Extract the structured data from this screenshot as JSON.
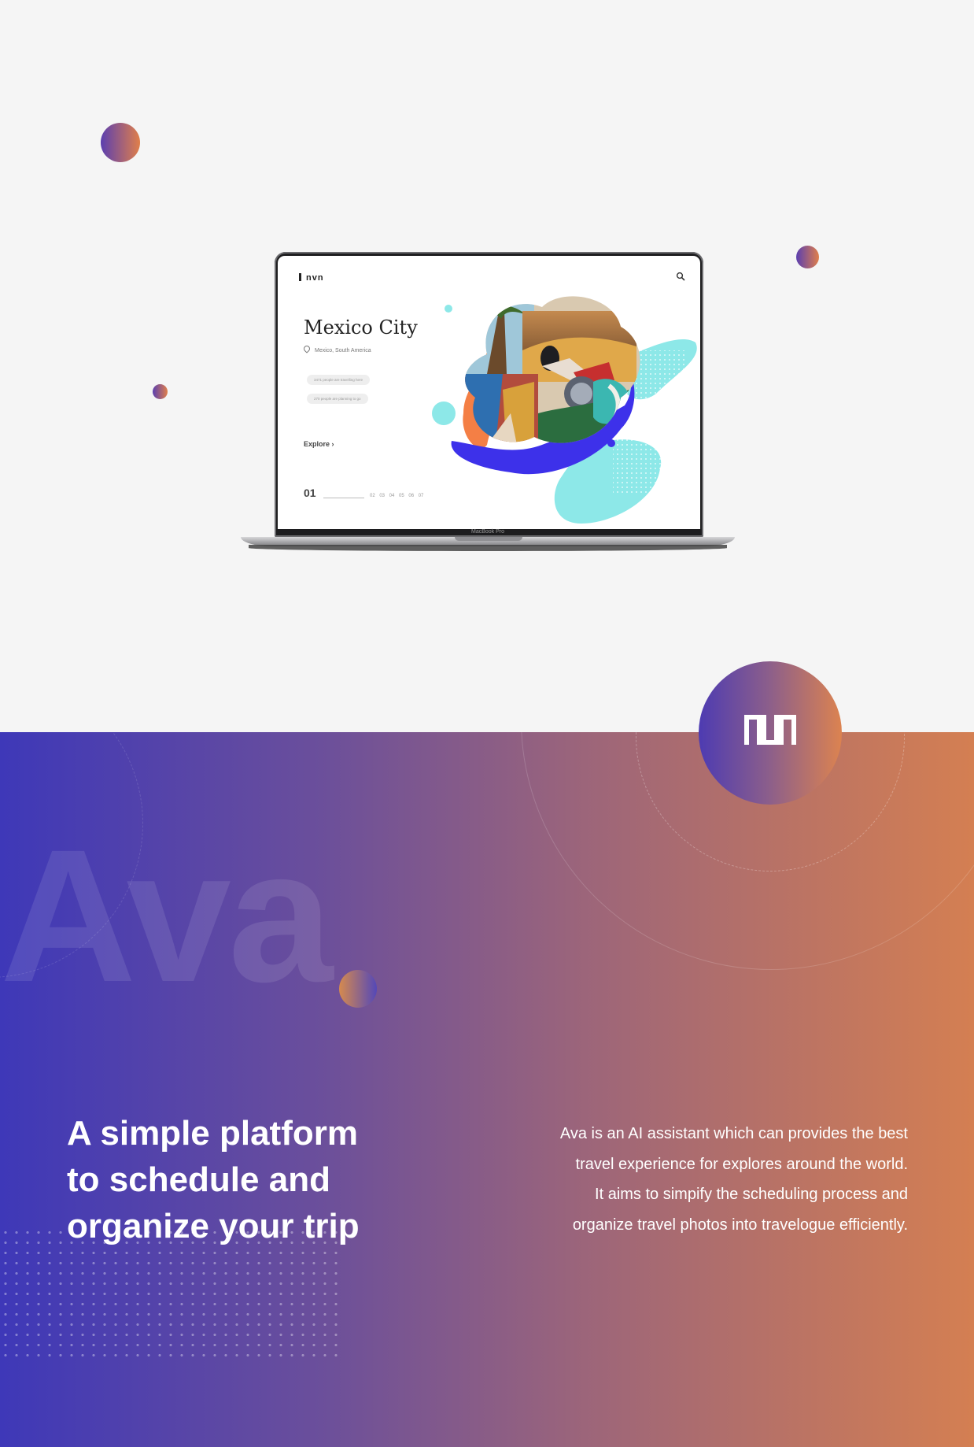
{
  "colors": {
    "accent_blue": "#3e38b8",
    "accent_orange": "#d47f52",
    "shape_cyan": "#8de8e8",
    "shape_indigo": "#3d31ea",
    "shape_coral": "#f47f45"
  },
  "laptop": {
    "device_label": "MacBook Pro",
    "app": {
      "logo": "nvn",
      "search_icon": "search-icon",
      "city": "Mexico City",
      "location": "Mexico, South America",
      "travelling_note": "3471 people are travelling here",
      "planning_note": "270 people are planning to go",
      "explore_label": "Explore",
      "current_page": "01",
      "pages": "02 03 04 05 06 07"
    }
  },
  "hero": {
    "watermark": "Ava",
    "headline": [
      "A simple platform",
      "to schedule and",
      "organize your trip"
    ],
    "description": [
      "Ava is an AI assistant which can provides the best",
      "travel experience for explores around the world.",
      "It aims to simpify the scheduling process and",
      "organize travel photos into travelogue efficiently."
    ],
    "badge_logo": "nvn-logo"
  }
}
